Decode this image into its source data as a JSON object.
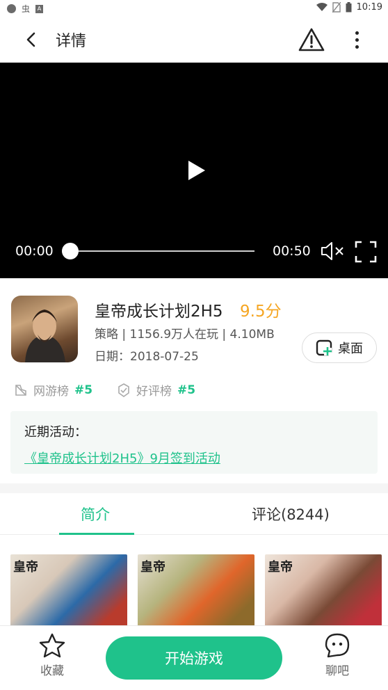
{
  "status_bar": {
    "time": "10:19",
    "icons": [
      "notification-dot-icon",
      "bug-icon",
      "a-icon",
      "wifi-icon",
      "no-sim-icon",
      "battery-icon"
    ],
    "glyph": "虫",
    "box_glyph": "A"
  },
  "header": {
    "title": "详情",
    "icons": [
      "back-arrow-icon",
      "warning-icon",
      "more-vert-icon"
    ]
  },
  "video": {
    "current_time": "00:00",
    "total_time": "00:50",
    "progress": 0,
    "icons": [
      "play-icon",
      "mute-icon",
      "fullscreen-icon"
    ]
  },
  "game": {
    "name": "皇帝成长计划2H5",
    "score": "9.5分",
    "meta": "策略 | 1156.9万人在玩 | 4.10MB",
    "date": "日期：2018-07-25",
    "desktop_button": "桌面"
  },
  "ranks": [
    {
      "label": "网游榜",
      "value": "#5",
      "icon": "online-game-rank-icon"
    },
    {
      "label": "好评榜",
      "value": "#5",
      "icon": "good-review-rank-icon"
    }
  ],
  "activity": {
    "title": "近期活动：",
    "link": "《皇帝成长计划2H5》9月签到活动"
  },
  "tabs": [
    {
      "label": "简介",
      "active": true
    },
    {
      "label": "评论(8244)",
      "active": false
    }
  ],
  "screenshots": [
    {
      "title": "皇帝"
    },
    {
      "title": "皇帝"
    },
    {
      "title": "皇帝"
    }
  ],
  "bottom_bar": {
    "favorite_label": "收藏",
    "start_label": "开始游戏",
    "chat_label": "聊吧"
  },
  "colors": {
    "accent": "#1fc28b",
    "score": "#f5a623",
    "video_bg": "#000000"
  }
}
